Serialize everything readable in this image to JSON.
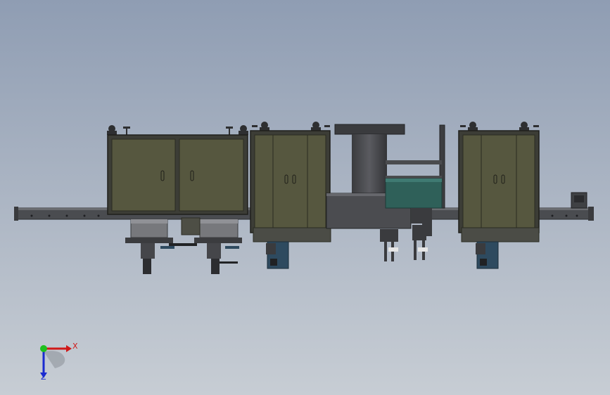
{
  "viewport": {
    "background_top": "#8f9db3",
    "background_bottom": "#c7cdd4"
  },
  "model": {
    "cabinet_color": "#56573f",
    "frame_color": "#3c3d36",
    "rail_color": "#4a4c50",
    "feeder_color": "#4b4c50",
    "conveyor_color": "#2f6059",
    "motor_color": "#2e4a5f"
  },
  "triad": {
    "x_label": "X",
    "z_label": "Z",
    "x_color": "#d01818",
    "y_color": "#1ec01e",
    "z_color": "#1a2bd0"
  }
}
